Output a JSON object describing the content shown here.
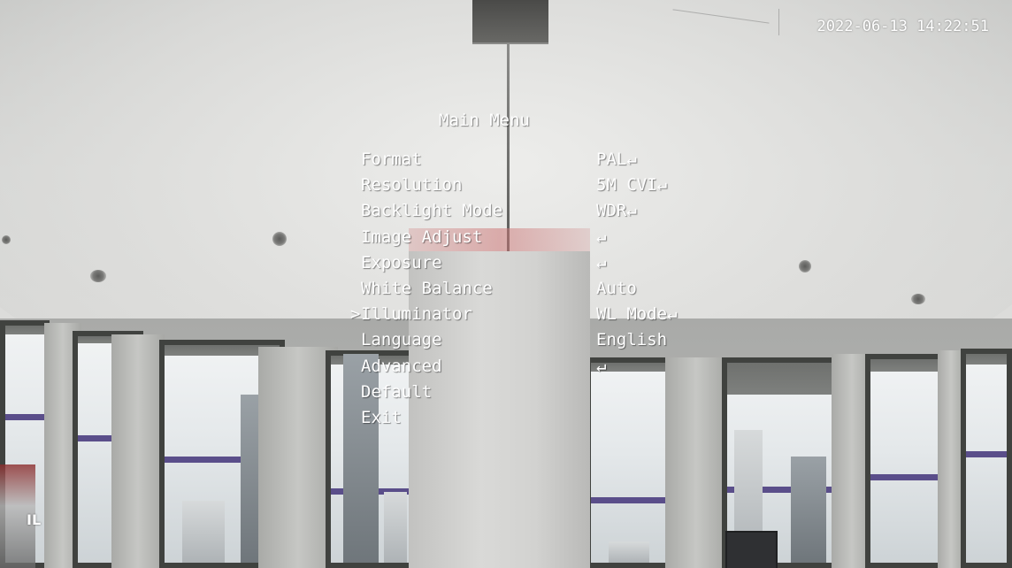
{
  "overlay": {
    "timestamp": "2022-06-13 14:22:51",
    "corner_label": "IL"
  },
  "menu": {
    "title": "Main Menu",
    "cursor_glyph": ">",
    "selected_index": 6,
    "items": [
      {
        "label": "Format",
        "value": "PAL↵"
      },
      {
        "label": "Resolution",
        "value": "5M CVI↵"
      },
      {
        "label": "Backlight Mode",
        "value": "WDR↵"
      },
      {
        "label": "Image Adjust",
        "value": "↵"
      },
      {
        "label": "Exposure",
        "value": "↵"
      },
      {
        "label": "White Balance",
        "value": "Auto"
      },
      {
        "label": "Illuminator",
        "value": "WL Mode↵"
      },
      {
        "label": "Language",
        "value": "English"
      },
      {
        "label": "Advanced",
        "value": "↵"
      },
      {
        "label": "Default",
        "value": ""
      },
      {
        "label": "Exit",
        "value": ""
      }
    ]
  },
  "colors": {
    "osd_text": "#ffffff",
    "window_sill_accent": "#5a4e8a"
  }
}
